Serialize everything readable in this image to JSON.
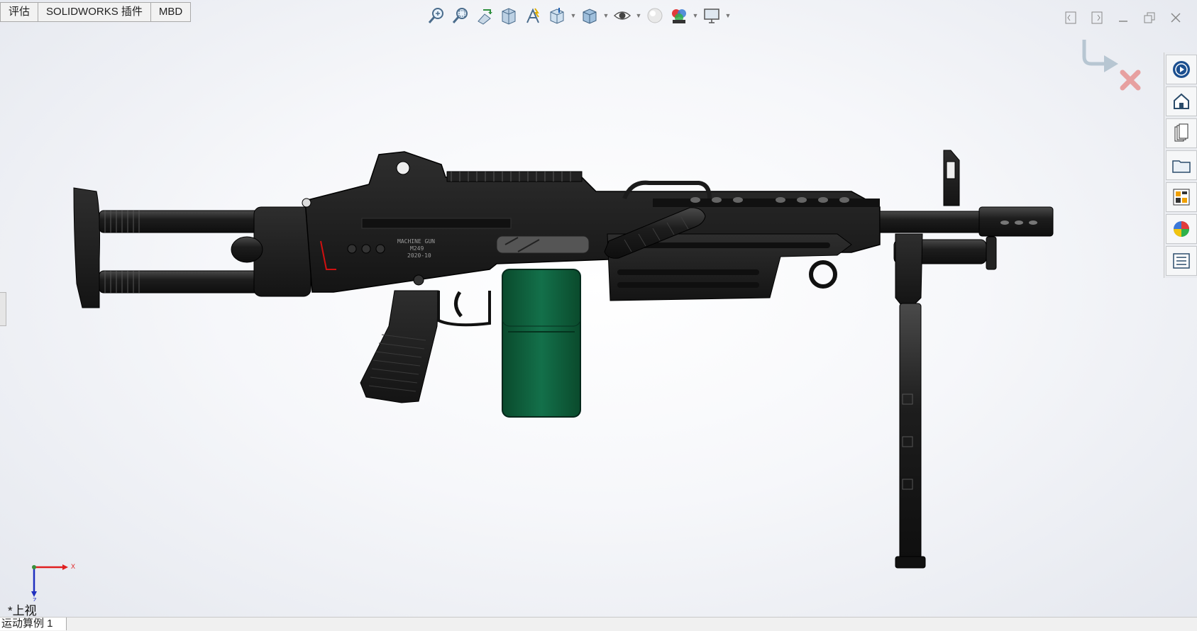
{
  "command_tabs": [
    {
      "label": "评估"
    },
    {
      "label": "SOLIDWORKS 插件"
    },
    {
      "label": "MBD"
    }
  ],
  "headsup_toolbar": {
    "icons": [
      "zoom-to-fit-icon",
      "zoom-to-area-icon",
      "previous-view-icon",
      "section-view-icon",
      "dynamic-annotation-icon",
      "view-orientation-icon",
      "display-style-icon",
      "hide-show-items-icon",
      "edit-appearance-icon",
      "apply-scene-icon",
      "view-settings-icon"
    ]
  },
  "taskpane": {
    "icons": [
      "solidworks-resources-icon",
      "design-library-icon",
      "file-explorer-icon",
      "view-palette-icon",
      "appearances-scenes-icon",
      "custom-properties-icon"
    ]
  },
  "triad": {
    "x_label": "X",
    "z_label": "Z"
  },
  "view_label": "*上视",
  "status_tab": "运动算例 1",
  "model_markings": [
    "MACHINE GUN",
    "M249",
    "2020-10"
  ],
  "colors": {
    "background": "#eef0f4",
    "part_black": "#1c1c1c",
    "magazine_green": "#0d5a37",
    "triad_x": "#e02020",
    "triad_z": "#1f2fbf"
  }
}
